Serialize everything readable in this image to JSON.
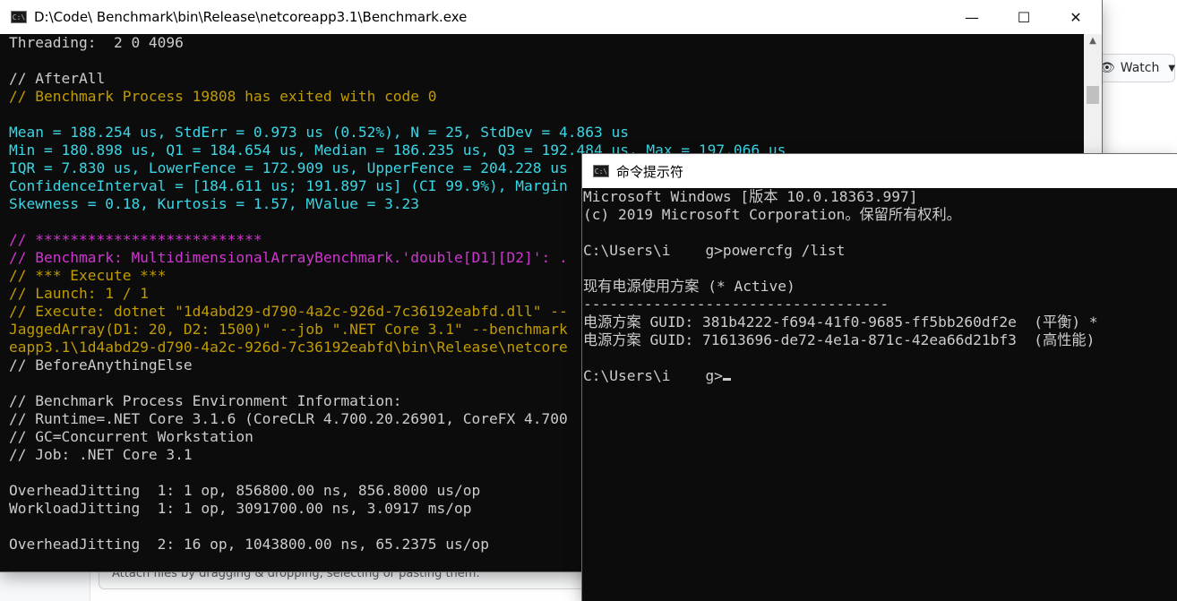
{
  "background": {
    "watch_label": "Watch",
    "comment_hint": "Attach files by dragging & dropping, selecting or pasting them."
  },
  "win1": {
    "title": "D:\\Code\\      Benchmark\\bin\\Release\\netcoreapp3.1\\Benchmark.exe",
    "icon_text": "C:\\",
    "controls": {
      "minimize": "—",
      "maximize": "☐",
      "close": "✕"
    },
    "lines": [
      {
        "t": "Threading:  2 0 4096",
        "c": "w"
      },
      {
        "t": "",
        "c": "w"
      },
      {
        "t": "// AfterAll",
        "c": "w"
      },
      {
        "t": "// Benchmark Process 19808 has exited with code 0",
        "c": "y"
      },
      {
        "t": "",
        "c": "w"
      },
      {
        "t": "Mean = 188.254 us, StdErr = 0.973 us (0.52%), N = 25, StdDev = 4.863 us",
        "c": "c"
      },
      {
        "t": "Min = 180.898 us, Q1 = 184.654 us, Median = 186.235 us, Q3 = 192.484 us, Max = 197.066 us",
        "c": "c"
      },
      {
        "t": "IQR = 7.830 us, LowerFence = 172.909 us, UpperFence = 204.228 us",
        "c": "c"
      },
      {
        "t": "ConfidenceInterval = [184.611 us; 191.897 us] (CI 99.9%), Margin",
        "c": "c"
      },
      {
        "t": "Skewness = 0.18, Kurtosis = 1.57, MValue = 3.23",
        "c": "c"
      },
      {
        "t": "",
        "c": "w"
      },
      {
        "t": "// **************************",
        "c": "m"
      },
      {
        "t": "// Benchmark: MultidimensionalArrayBenchmark.'double[D1][D2]': .",
        "c": "m"
      },
      {
        "t": "// *** Execute ***",
        "c": "y"
      },
      {
        "t": "// Launch: 1 / 1",
        "c": "y"
      },
      {
        "t": "// Execute: dotnet \"1d4abd29-d790-4a2c-926d-7c36192eabfd.dll\" --",
        "c": "y"
      },
      {
        "t": "JaggedArray(D1: 20, D2: 1500)\" --job \".NET Core 3.1\" --benchmark",
        "c": "y"
      },
      {
        "t": "eapp3.1\\1d4abd29-d790-4a2c-926d-7c36192eabfd\\bin\\Release\\netcore",
        "c": "y"
      },
      {
        "t": "// BeforeAnythingElse",
        "c": "w"
      },
      {
        "t": "",
        "c": "w"
      },
      {
        "t": "// Benchmark Process Environment Information:",
        "c": "w"
      },
      {
        "t": "// Runtime=.NET Core 3.1.6 (CoreCLR 4.700.20.26901, CoreFX 4.700",
        "c": "w"
      },
      {
        "t": "// GC=Concurrent Workstation",
        "c": "w"
      },
      {
        "t": "// Job: .NET Core 3.1",
        "c": "w"
      },
      {
        "t": "",
        "c": "w"
      },
      {
        "t": "OverheadJitting  1: 1 op, 856800.00 ns, 856.8000 us/op",
        "c": "w"
      },
      {
        "t": "WorkloadJitting  1: 1 op, 3091700.00 ns, 3.0917 ms/op",
        "c": "w"
      },
      {
        "t": "",
        "c": "w"
      },
      {
        "t": "OverheadJitting  2: 16 op, 1043800.00 ns, 65.2375 us/op",
        "c": "w"
      }
    ]
  },
  "win2": {
    "title": "命令提示符",
    "icon_text": "C:\\",
    "lines": [
      {
        "t": "Microsoft Windows [版本 10.0.18363.997]",
        "c": "w"
      },
      {
        "t": "(c) 2019 Microsoft Corporation。保留所有权利。",
        "c": "w"
      },
      {
        "t": "",
        "c": "w"
      },
      {
        "t": "C:\\Users\\i    g>powercfg /list",
        "c": "w"
      },
      {
        "t": "",
        "c": "w"
      },
      {
        "t": "现有电源使用方案 (* Active)",
        "c": "w"
      },
      {
        "t": "-----------------------------------",
        "c": "w"
      },
      {
        "t": "电源方案 GUID: 381b4222-f694-41f0-9685-ff5bb260df2e  (平衡) *",
        "c": "w"
      },
      {
        "t": "电源方案 GUID: 71613696-de72-4e1a-871c-42ea66d21bf3  (高性能)",
        "c": "w"
      },
      {
        "t": "",
        "c": "w"
      },
      {
        "t": "C:\\Users\\i    g>",
        "c": "w",
        "cursor": true
      }
    ]
  }
}
